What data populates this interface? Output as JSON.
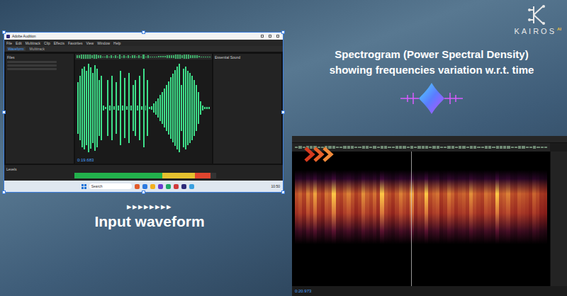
{
  "brand": {
    "name": "KAIROS",
    "suffix": "AI"
  },
  "headline": [
    "Spectrogram (Power Spectral Density)",
    "showing frequencies variation w.r.t. time"
  ],
  "caption": {
    "arrows": "▸▸▸▸▸▸▸▸",
    "label": "Input waveform"
  },
  "waveform_window": {
    "title": "Adobe Audition",
    "menu": [
      "File",
      "Edit",
      "Multitrack",
      "Clip",
      "Effects",
      "Favorites",
      "View",
      "Window",
      "Help"
    ],
    "tabs": [
      {
        "label": "Waveform",
        "selected": true
      },
      {
        "label": "Multitrack",
        "selected": false
      }
    ],
    "files_panel": "Files",
    "side_panel": "Essential Sound",
    "time": "0:19.683",
    "levels_label": "Levels",
    "level_meter": {
      "level": 0.96
    },
    "envelope": [
      0.55,
      0.7,
      0.85,
      0.9,
      0.8,
      0.95,
      0.88,
      0.75,
      0.92,
      0.85,
      0.6,
      0.7,
      0.05,
      0.03,
      0.6,
      0.05,
      0.7,
      0.04,
      0.55,
      0.06,
      0.8,
      0.05,
      0.65,
      0.04,
      0.75,
      0.05,
      0.5,
      0.6,
      0.05,
      0.7,
      0.04,
      0.85,
      0.05,
      0.6,
      0.03,
      0.04,
      0.1,
      0.15,
      0.2,
      0.28,
      0.35,
      0.42,
      0.5,
      0.58,
      0.66,
      0.74,
      0.82,
      0.9,
      0.96,
      0.5,
      0.85,
      0.9,
      0.8,
      0.75,
      0.7,
      0.6,
      0.5,
      0.35,
      0.15,
      0.05,
      0.03,
      0.02,
      0.02
    ],
    "taskbar": {
      "search": "Search",
      "clock": "10:50"
    }
  },
  "spectrogram_window": {
    "time": "0:20.973",
    "columns": [
      0.6,
      0.7,
      0.55,
      0.8,
      0.65,
      0.9,
      0.6,
      0.5,
      0.75,
      0.7,
      1.0,
      0.6,
      0.55,
      0.7,
      0.8,
      0.65,
      0.5,
      0.6,
      0.85,
      0.7,
      0.6,
      0.75,
      0.55,
      1.0,
      0.7,
      0.6,
      0.5,
      0.65,
      0.8,
      0.7,
      0.6,
      0.9,
      0.55,
      0.7,
      0.65,
      1.0,
      0.6,
      0.7,
      0.75,
      0.5,
      0.6,
      0.8,
      0.7,
      0.55,
      0.65,
      0.7,
      0.6,
      0.85,
      0.7,
      0.6,
      0.55,
      0.75,
      0.7,
      0.6,
      1.0,
      0.65,
      0.7,
      0.8,
      0.6,
      0.55,
      0.7,
      0.65,
      0.6,
      0.5,
      0.7,
      0.6,
      0.45,
      0.4
    ]
  }
}
